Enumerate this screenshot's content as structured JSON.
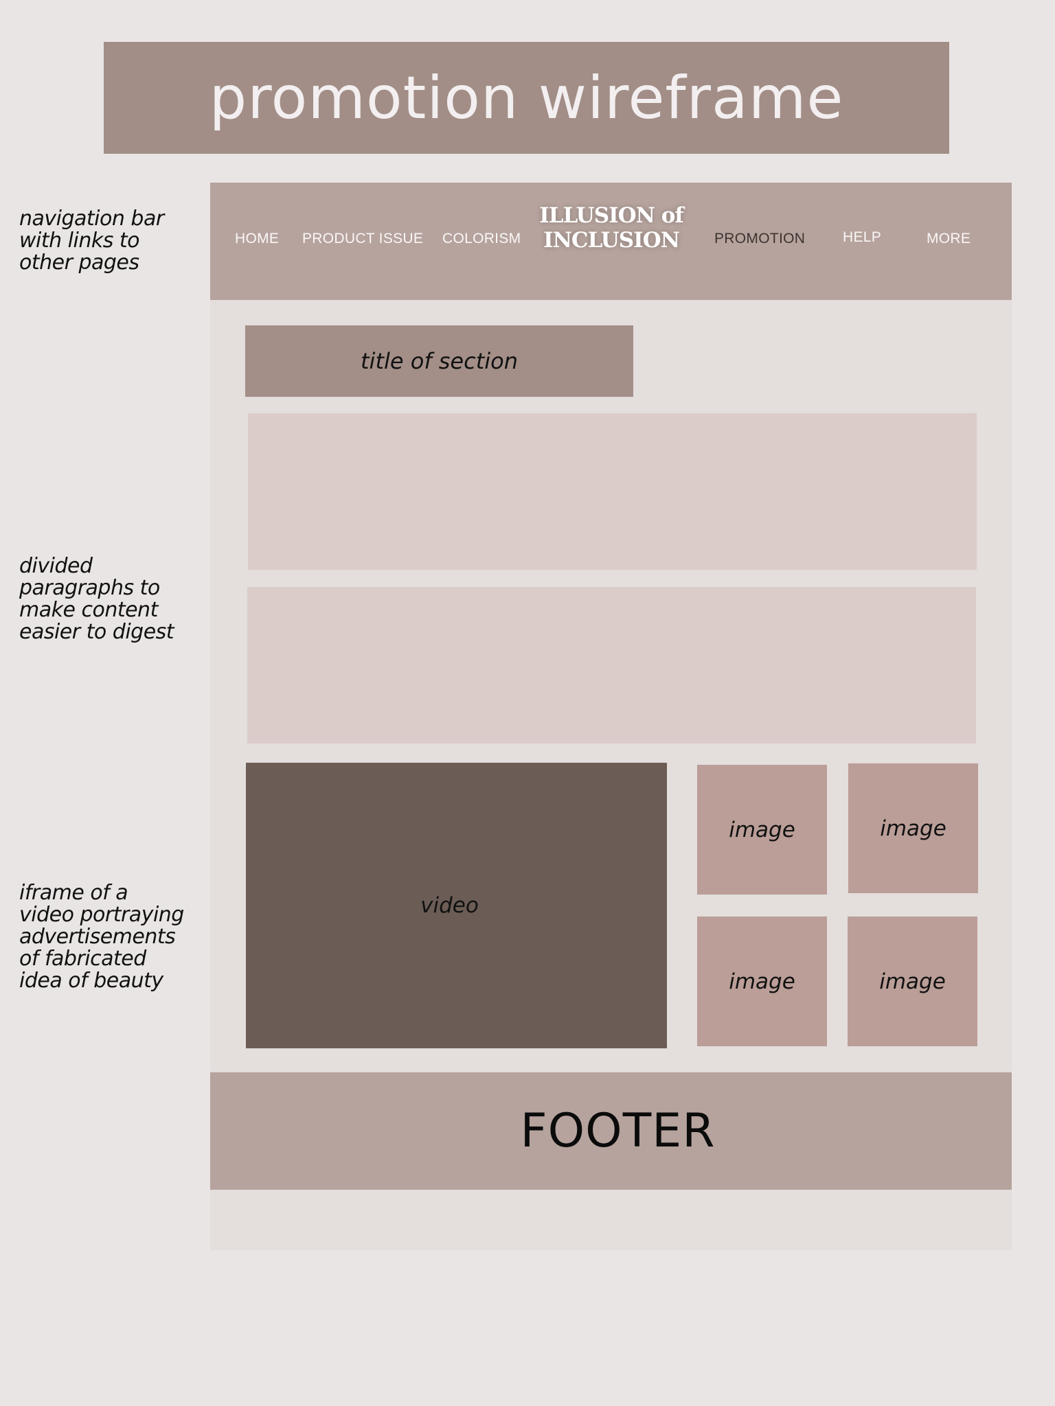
{
  "banner": {
    "title": "promotion wireframe"
  },
  "notes": {
    "nav": "navigation bar\nwith links to\nother pages",
    "paragraphs": "divided\nparagraphs to\nmake content\neasier to digest",
    "video": "iframe of a\nvideo portraying\nadvertisements\nof fabricated\nidea of beauty"
  },
  "nav": {
    "links": [
      "HOME",
      "PRODUCT ISSUE",
      "COLORISM",
      "PROMOTION",
      "HELP",
      "MORE"
    ],
    "logo": "ILLUSION of\nINCLUSION"
  },
  "section": {
    "title": "title of section"
  },
  "media": {
    "video_label": "video",
    "image_labels": [
      "image",
      "image",
      "image",
      "image"
    ]
  },
  "footer": {
    "label": "FOOTER"
  },
  "colors": {
    "background": "#e9e5e4",
    "banner": "#a28e87",
    "nav": "#b6a39d",
    "paragraph_block": "#dbccc9",
    "video_block": "#6b5d56",
    "image_block": "#ba9e97"
  }
}
